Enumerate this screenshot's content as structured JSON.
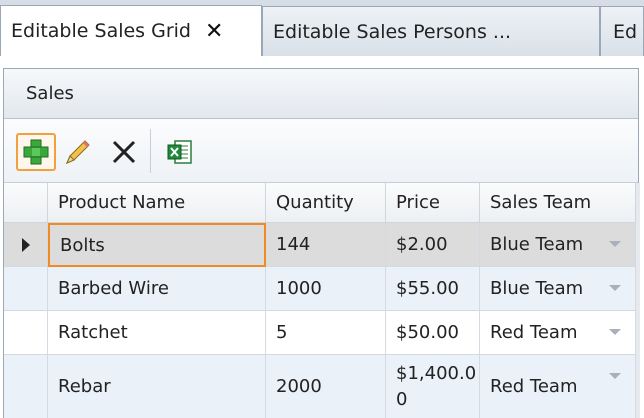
{
  "tabs": [
    {
      "label": "Editable Sales Grid",
      "active": true,
      "closable": true
    },
    {
      "label": "Editable Sales Persons ...",
      "active": false,
      "closable": false
    },
    {
      "label": "Ed",
      "active": false,
      "closable": false
    }
  ],
  "tab_close_glyph": "✕",
  "panel": {
    "title": "Sales"
  },
  "toolbar": {
    "add_icon": "plus-icon",
    "edit_icon": "pencil-icon",
    "delete_icon": "x-icon",
    "export_icon": "excel-icon"
  },
  "grid": {
    "columns": [
      "Product Name",
      "Quantity",
      "Price",
      "Sales Team"
    ],
    "rows": [
      {
        "product": "Bolts",
        "quantity": "144",
        "price": "$2.00",
        "team": "Blue Team"
      },
      {
        "product": "Barbed Wire",
        "quantity": "1000",
        "price": "$55.00",
        "team": "Blue Team"
      },
      {
        "product": "Ratchet",
        "quantity": "5",
        "price": "$50.00",
        "team": "Red Team"
      },
      {
        "product": "Rebar",
        "quantity": "2000",
        "price": "$1,400.00",
        "team": "Red Team"
      }
    ]
  },
  "colors": {
    "selected_row": "#dcdcdc",
    "alt_row": "#eaf1f9",
    "focus_border": "#f08a24",
    "selected_button_border": "#f0a040"
  }
}
